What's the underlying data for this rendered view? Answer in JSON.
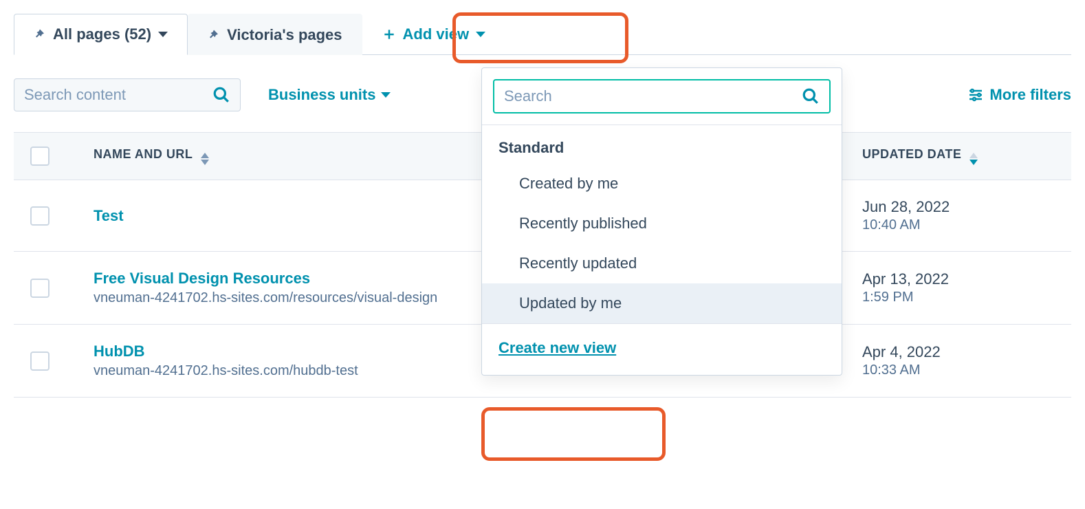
{
  "tabs": {
    "all_pages": {
      "label": "All pages",
      "count": "(52)"
    },
    "victoria": {
      "label": "Victoria's pages"
    },
    "add_view": {
      "label": "Add view"
    }
  },
  "toolbar": {
    "search_placeholder": "Search content",
    "business_units": "Business units",
    "more_filters": "More filters"
  },
  "table": {
    "headers": {
      "name": "NAME AND URL",
      "updated": "UPDATED DATE"
    },
    "rows": [
      {
        "name": "Test",
        "url": "",
        "date": "Jun 28, 2022",
        "time": "10:40 AM"
      },
      {
        "name": "Free Visual Design Resources",
        "url": "vneuman-4241702.hs-sites.com/resources/visual-design",
        "date": "Apr 13, 2022",
        "time": "1:59 PM"
      },
      {
        "name": "HubDB",
        "url": "vneuman-4241702.hs-sites.com/hubdb-test",
        "date": "Apr 4, 2022",
        "time": "10:33 AM"
      }
    ]
  },
  "popover": {
    "search_placeholder": "Search",
    "section_label": "Standard",
    "items": [
      "Created by me",
      "Recently published",
      "Recently updated",
      "Updated by me"
    ],
    "create_new": "Create new view"
  }
}
